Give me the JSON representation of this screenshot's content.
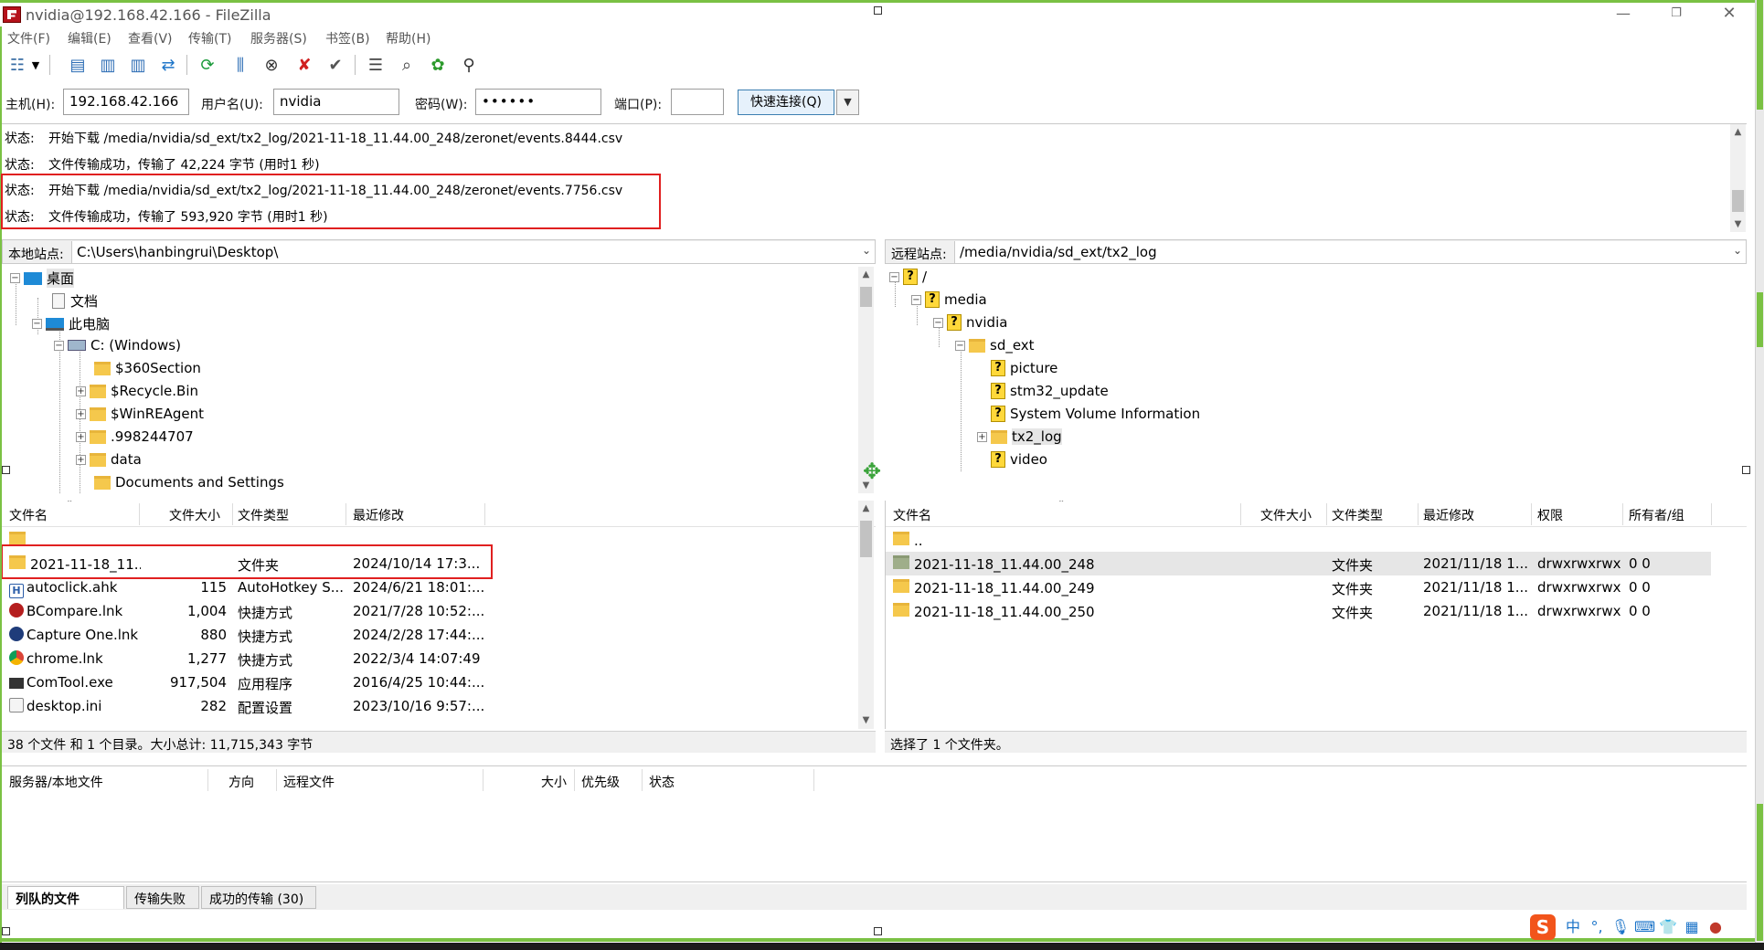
{
  "window": {
    "title": "nvidia@192.168.42.166 - FileZilla"
  },
  "menu": [
    "文件(F)",
    "编辑(E)",
    "查看(V)",
    "传输(T)",
    "服务器(S)",
    "书签(B)",
    "帮助(H)"
  ],
  "quickconnect": {
    "host_label": "主机(H):",
    "host_value": "192.168.42.166",
    "user_label": "用户名(U):",
    "user_value": "nvidia",
    "pass_label": "密码(W):",
    "pass_value": "••••••",
    "port_label": "端口(P):",
    "port_value": "",
    "connect_label": "快速连接(Q)"
  },
  "log": [
    {
      "key": "状态:",
      "text": "开始下载 /media/nvidia/sd_ext/tx2_log/2021-11-18_11.44.00_248/zeronet/events.8444.csv"
    },
    {
      "key": "状态:",
      "text": "文件传输成功，传输了 42,224 字节 (用时1 秒)"
    },
    {
      "key": "状态:",
      "text": "开始下载 /media/nvidia/sd_ext/tx2_log/2021-11-18_11.44.00_248/zeronet/events.7756.csv"
    },
    {
      "key": "状态:",
      "text": "文件传输成功，传输了 593,920 字节 (用时1 秒)"
    }
  ],
  "local": {
    "site_label": "本地站点:",
    "path": "C:\\Users\\hanbingrui\\Desktop\\",
    "tree": {
      "desktop": "桌面",
      "documents": "文档",
      "thispc": "此电脑",
      "c_drive": "C: (Windows)",
      "folders": [
        "$360Section",
        "$Recycle.Bin",
        "$WinREAgent",
        ".998244707",
        "data",
        "Documents and Settings"
      ]
    },
    "columns": [
      "文件名",
      "文件大小",
      "文件类型",
      "最近修改"
    ],
    "rows": [
      {
        "name": "2021-11-18_11...",
        "size": "",
        "type": "文件夹",
        "modified": "2024/10/14 17:3..."
      },
      {
        "name": "autoclick.ahk",
        "size": "115",
        "type": "AutoHotkey S...",
        "modified": "2024/6/21 18:01:..."
      },
      {
        "name": "BCompare.lnk",
        "size": "1,004",
        "type": "快捷方式",
        "modified": "2021/7/28 10:52:..."
      },
      {
        "name": "Capture One.lnk",
        "size": "880",
        "type": "快捷方式",
        "modified": "2024/2/28 17:44:..."
      },
      {
        "name": "chrome.lnk",
        "size": "1,277",
        "type": "快捷方式",
        "modified": "2022/3/4 14:07:49"
      },
      {
        "name": "ComTool.exe",
        "size": "917,504",
        "type": "应用程序",
        "modified": "2016/4/25 10:44:..."
      },
      {
        "name": "desktop.ini",
        "size": "282",
        "type": "配置设置",
        "modified": "2023/10/16 9:57:..."
      }
    ],
    "status": "38 个文件 和 1 个目录。大小总计: 11,715,343 字节"
  },
  "remote": {
    "site_label": "远程站点:",
    "path": "/media/nvidia/sd_ext/tx2_log",
    "tree": {
      "root": "/",
      "media": "media",
      "nvidia": "nvidia",
      "sd_ext": "sd_ext",
      "children": [
        "picture",
        "stm32_update",
        "System Volume Information",
        "tx2_log",
        "video"
      ]
    },
    "columns": [
      "文件名",
      "文件大小",
      "文件类型",
      "最近修改",
      "权限",
      "所有者/组"
    ],
    "rows": [
      {
        "name": "..",
        "size": "",
        "type": "",
        "modified": "",
        "perm": "",
        "owner": ""
      },
      {
        "name": "2021-11-18_11.44.00_248",
        "size": "",
        "type": "文件夹",
        "modified": "2021/11/18 1...",
        "perm": "drwxrwxrwx",
        "owner": "0 0"
      },
      {
        "name": "2021-11-18_11.44.00_249",
        "size": "",
        "type": "文件夹",
        "modified": "2021/11/18 1...",
        "perm": "drwxrwxrwx",
        "owner": "0 0"
      },
      {
        "name": "2021-11-18_11.44.00_250",
        "size": "",
        "type": "文件夹",
        "modified": "2021/11/18 1...",
        "perm": "drwxrwxrwx",
        "owner": "0 0"
      }
    ],
    "status": "选择了 1 个文件夹。"
  },
  "queue": {
    "columns": [
      "服务器/本地文件",
      "方向",
      "远程文件",
      "大小",
      "优先级",
      "状态"
    ],
    "tabs": [
      "列队的文件",
      "传输失败",
      "成功的传输 (30)"
    ]
  },
  "tray": {
    "ime": "中"
  },
  "colors": {
    "accent_green": "#7ac143",
    "highlight_red": "#e02020",
    "folder": "#f5c84c",
    "selection": "#e6e6e6"
  }
}
